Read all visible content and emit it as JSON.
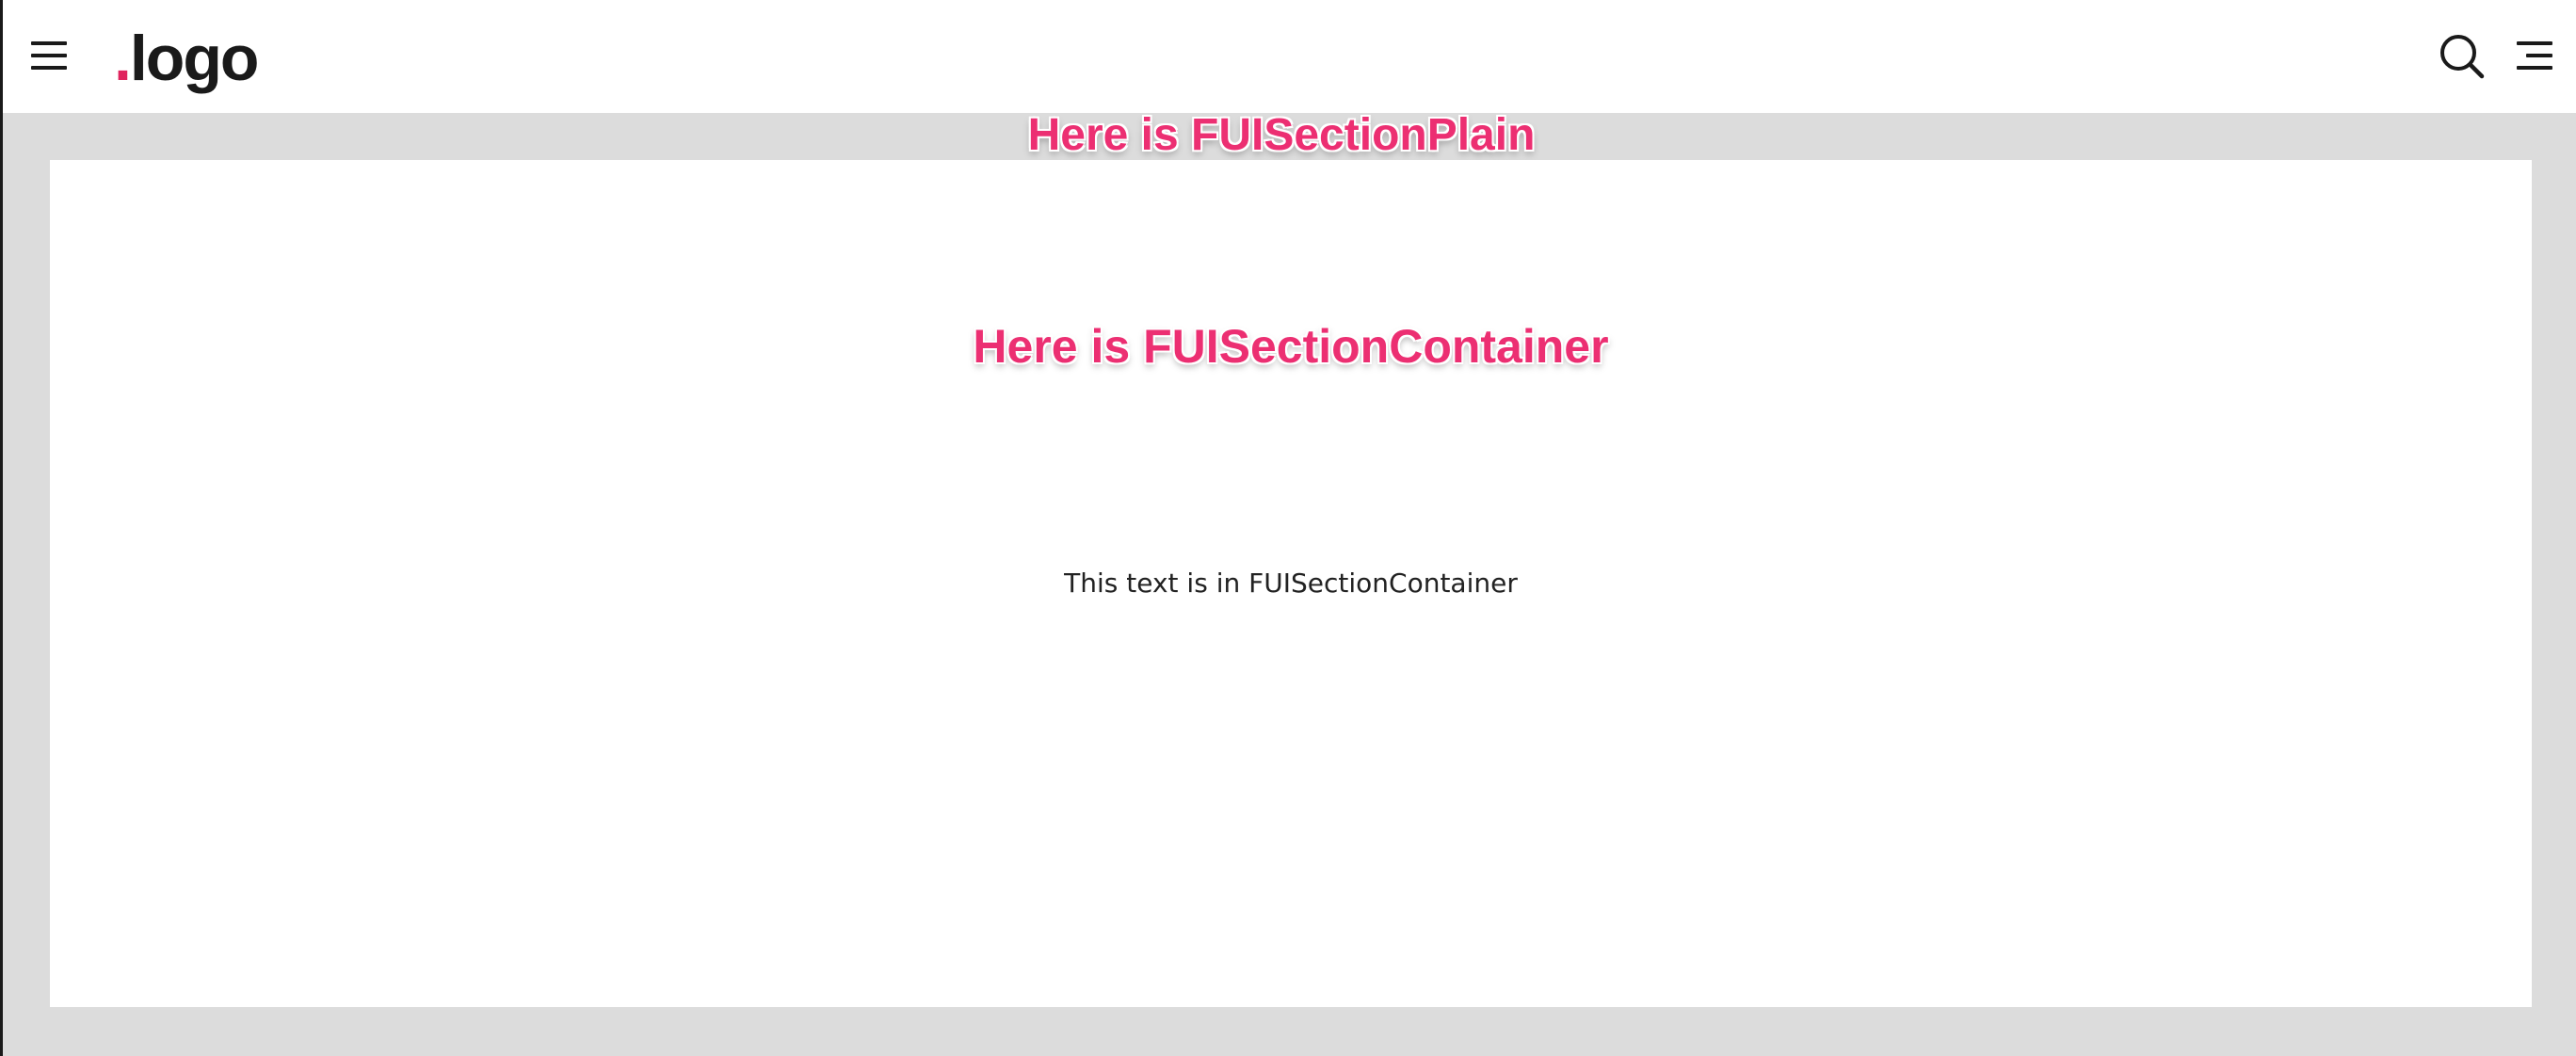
{
  "header": {
    "logo_dot": ".",
    "logo_text": "logo",
    "icons": {
      "menu": "hamburger-menu-icon",
      "search": "search-icon",
      "filter": "filter-lines-icon"
    }
  },
  "sections": {
    "plain_heading": "Here is FUISectionPlain",
    "container_heading": "Here is FUISectionContainer",
    "container_text": "This text is in FUISectionContainer"
  },
  "colors": {
    "accent": "#ec2f72",
    "background": "#dcdcdc",
    "surface": "#ffffff",
    "text": "#1a1a1a"
  }
}
